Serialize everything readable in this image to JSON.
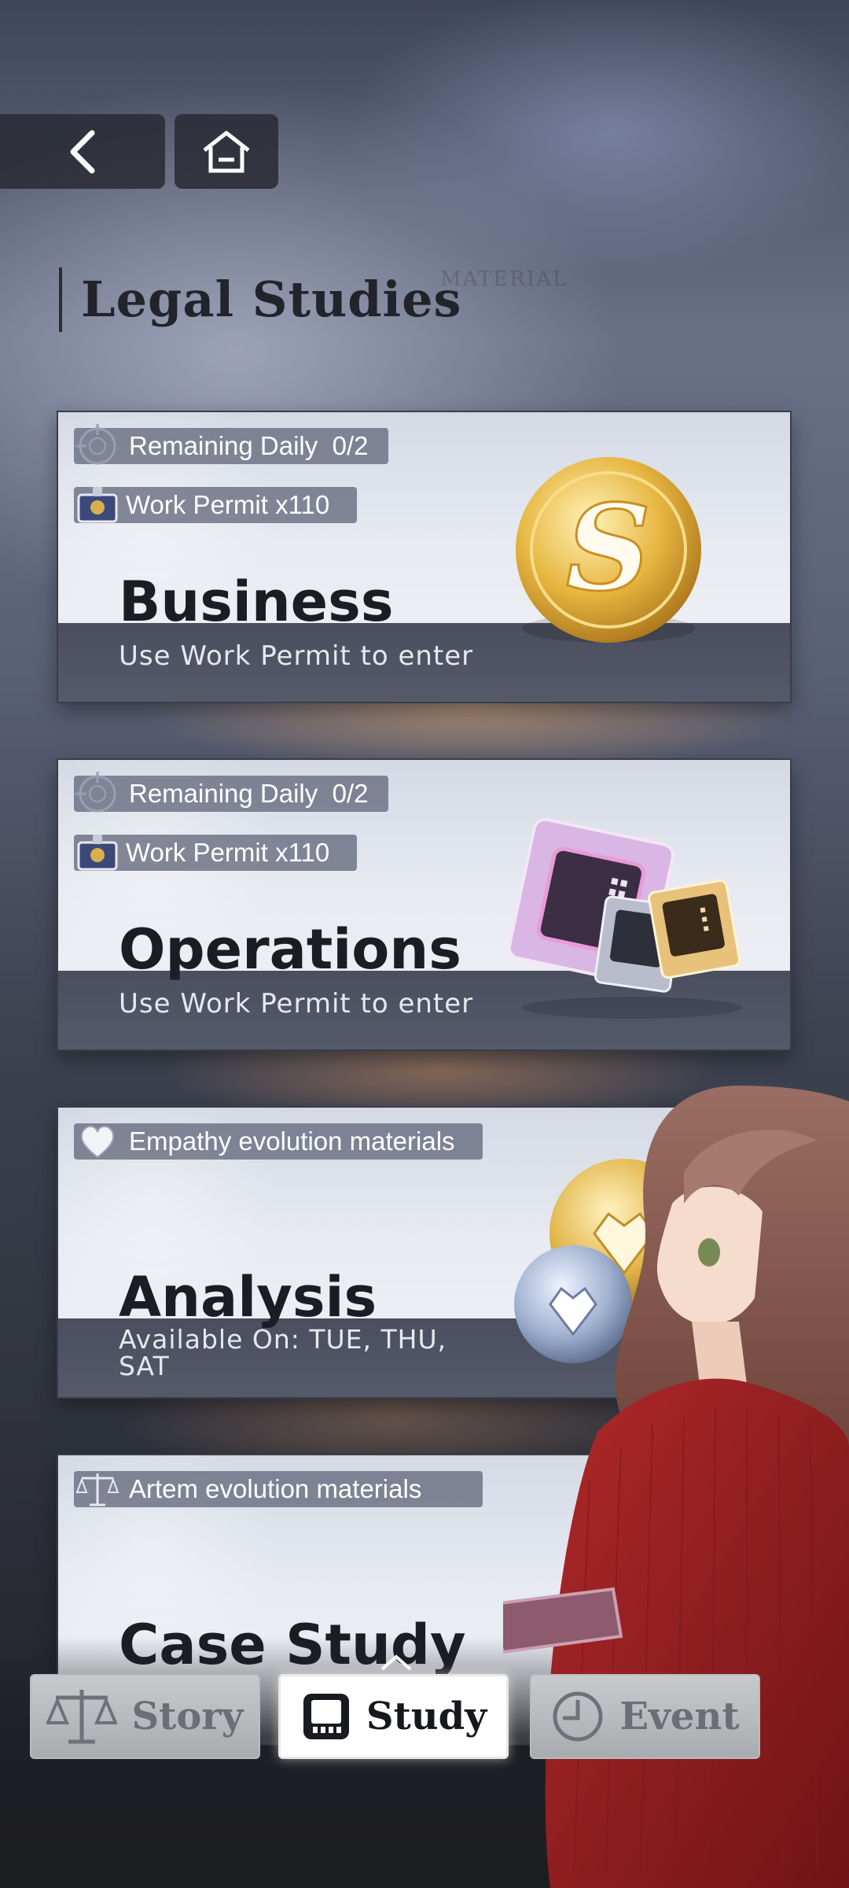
{
  "header": {
    "title": "Legal  Studies",
    "ghost_label": "MATERIAL"
  },
  "cards": [
    {
      "title": "Business",
      "subtitle": "Use Work Permit to enter",
      "daily_label": "Remaining Daily",
      "daily_value": "0/2",
      "permit_label": "Work Permit x110"
    },
    {
      "title": "Operations",
      "subtitle": "Use Work Permit to enter",
      "daily_label": "Remaining Daily",
      "daily_value": "0/2",
      "permit_label": "Work Permit x110"
    },
    {
      "title": "Analysis",
      "subtitle": "Available On: TUE, THU, SAT",
      "material_label": "Empathy evolution materials"
    },
    {
      "title": "Case Study",
      "material_label": "Artem evolution materials"
    }
  ],
  "tabs": [
    {
      "label": "Story",
      "icon": "scales-icon",
      "active": false
    },
    {
      "label": "Study",
      "icon": "book-icon",
      "active": true
    },
    {
      "label": "Event",
      "icon": "clock-icon",
      "active": false
    }
  ],
  "colors": {
    "accent_gold": "#e0b040",
    "card_band": "#4a4e5e",
    "title_dark": "#1c1d24"
  }
}
